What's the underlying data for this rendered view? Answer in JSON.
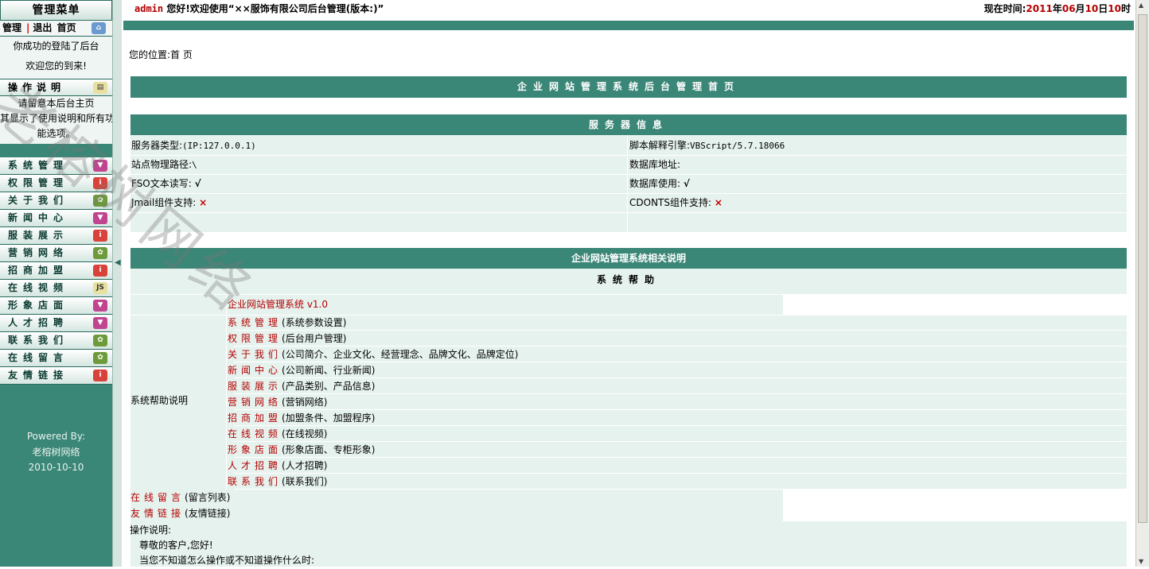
{
  "sidebar": {
    "title": "管理菜单",
    "links": {
      "manage": "管理",
      "separator": "|",
      "logout": "退出",
      "home": "首页"
    },
    "welcome": [
      "你成功的登陆了后台",
      "欢迎您的到来!"
    ],
    "guide_title": "操作说明",
    "guide_text": [
      "请留意本后台主页",
      "其显示了使用说明和所有功",
      "能选项。"
    ],
    "menu": [
      {
        "label": "系统管理",
        "icon": "pink"
      },
      {
        "label": "权限管理",
        "icon": "red"
      },
      {
        "label": "关于我们",
        "icon": "green"
      },
      {
        "label": "新闻中心",
        "icon": "pink"
      },
      {
        "label": "服装展示",
        "icon": "red"
      },
      {
        "label": "营销网络",
        "icon": "green"
      },
      {
        "label": "招商加盟",
        "icon": "red"
      },
      {
        "label": "在线视频",
        "icon": "js"
      },
      {
        "label": "形象店面",
        "icon": "pink"
      },
      {
        "label": "人才招聘",
        "icon": "pink"
      },
      {
        "label": "联系我们",
        "icon": "green"
      },
      {
        "label": "在线留言",
        "icon": "green"
      },
      {
        "label": "友情链接",
        "icon": "red"
      }
    ],
    "footer": {
      "powered": "Powered By:",
      "company": "老榕树网络",
      "date": "2010-10-10"
    }
  },
  "header": {
    "user": "admin",
    "greeting": "您好!欢迎使用“××服饰有限公司后台管理(版本:)”",
    "time_label": "现在时间:",
    "year": "2011",
    "year_unit": "年",
    "month": "06",
    "month_unit": "月",
    "day": "10",
    "day_unit": "日",
    "hour": "10",
    "hour_unit": "时"
  },
  "breadcrumb": "您的位置:首 页",
  "main_title": "企业网站管理系统后台管理首页",
  "server": {
    "title": "服务器信息",
    "left": [
      {
        "label": "服务器类型:",
        "value": "(IP:127.0.0.1)"
      },
      {
        "label": "站点物理路径:",
        "value": "\\"
      },
      {
        "label": "FSO文本读写:",
        "value": "√"
      },
      {
        "label": "Jmail组件支持:",
        "value": "×"
      }
    ],
    "right": [
      {
        "label": "脚本解释引擎:",
        "value": "VBScript/5.7.18066"
      },
      {
        "label": "数据库地址:",
        "value": ""
      },
      {
        "label": "数据库使用:",
        "value": "√"
      },
      {
        "label": "CDONTS组件支持:",
        "value": "×"
      }
    ]
  },
  "help_section": {
    "title": "企业网站管理系统相关说明",
    "subtitle": "系统帮助",
    "side_label": "系统帮助说明",
    "product": "企业网站管理系统 v1.0",
    "items": [
      {
        "link": "系统管理",
        "desc": "(系统参数设置)"
      },
      {
        "link": "权限管理",
        "desc": "(后台用户管理)"
      },
      {
        "link": "关于我们",
        "desc": "(公司简介、企业文化、经营理念、品牌文化、品牌定位)"
      },
      {
        "link": "新闻中心",
        "desc": "(公司新闻、行业新闻)"
      },
      {
        "link": "服装展示",
        "desc": "(产品类别、产品信息)"
      },
      {
        "link": "营销网络",
        "desc": "(营销网络)"
      },
      {
        "link": "招商加盟",
        "desc": "(加盟条件、加盟程序)"
      },
      {
        "link": "在线视频",
        "desc": "(在线视频)"
      },
      {
        "link": "形象店面",
        "desc": "(形象店面、专柜形象)"
      },
      {
        "link": "人才招聘",
        "desc": "(人才招聘)"
      },
      {
        "link": "联系我们",
        "desc": "(联系我们)"
      }
    ],
    "extra": [
      {
        "link": "在线留言",
        "desc": "(留言列表)"
      },
      {
        "link": "友情链接",
        "desc": "(友情链接)"
      }
    ]
  },
  "operation": {
    "title": "操作说明:",
    "lines": [
      "尊敬的客户,您好!",
      "当您不知道怎么操作或不知道操作什么时:"
    ]
  },
  "watermark": "老榕树网络"
}
